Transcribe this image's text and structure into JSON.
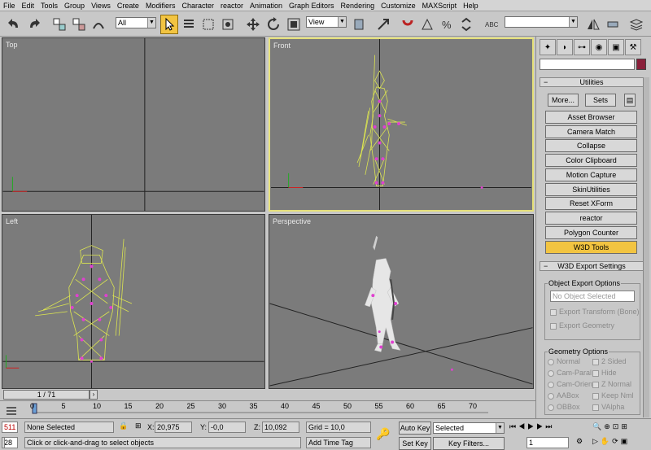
{
  "menu": [
    "File",
    "Edit",
    "Tools",
    "Group",
    "Views",
    "Create",
    "Modifiers",
    "Character",
    "reactor",
    "Animation",
    "Graph Editors",
    "Rendering",
    "Customize",
    "MAXScript",
    "Help"
  ],
  "toolbar": {
    "filter": "All",
    "view": "View"
  },
  "viewports": {
    "top": "Top",
    "front": "Front",
    "left": "Left",
    "perspective": "Perspective"
  },
  "panel": {
    "rollout_title": "Utilities",
    "more": "More...",
    "sets": "Sets",
    "buttons": [
      "Asset Browser",
      "Camera Match",
      "Collapse",
      "Color Clipboard",
      "Motion Capture",
      "SkinUtilities",
      "Reset XForm",
      "reactor",
      "Polygon Counter",
      "W3D Tools"
    ],
    "export_title": "W3D Export Settings",
    "object_group": "Object Export Options",
    "no_object": "No Object Selected",
    "export_transform": "Export Transform (Bone)",
    "export_geometry": "Export Geometry",
    "geometry_group": "Geometry Options",
    "geom_left": [
      "Normal",
      "Cam-Paral",
      "Cam-Orient",
      "AABox",
      "OBBox"
    ],
    "geom_right": [
      "2 Sided",
      "Hide",
      "Z Normal",
      "Keep Nml",
      "VAlpha"
    ]
  },
  "time": {
    "frame": "1 / 71",
    "ticks": [
      "0",
      "5",
      "10",
      "15",
      "20",
      "25",
      "30",
      "35",
      "40",
      "45",
      "50",
      "55",
      "60",
      "65",
      "70"
    ]
  },
  "status": {
    "sel_count": "511",
    "line2": "28",
    "selection": "None Selected",
    "x_label": "X:",
    "x": "20,975",
    "y_label": "Y:",
    "y": "-0,0",
    "z_label": "Z:",
    "z": "10,092",
    "grid": "Grid = 10,0",
    "add_time_tag": "Add Time Tag",
    "auto_key": "Auto Key",
    "set_key": "Set Key",
    "selected": "Selected",
    "key_filters": "Key Filters...",
    "frame": "1",
    "prompt": "Click or click-and-drag to select objects"
  }
}
